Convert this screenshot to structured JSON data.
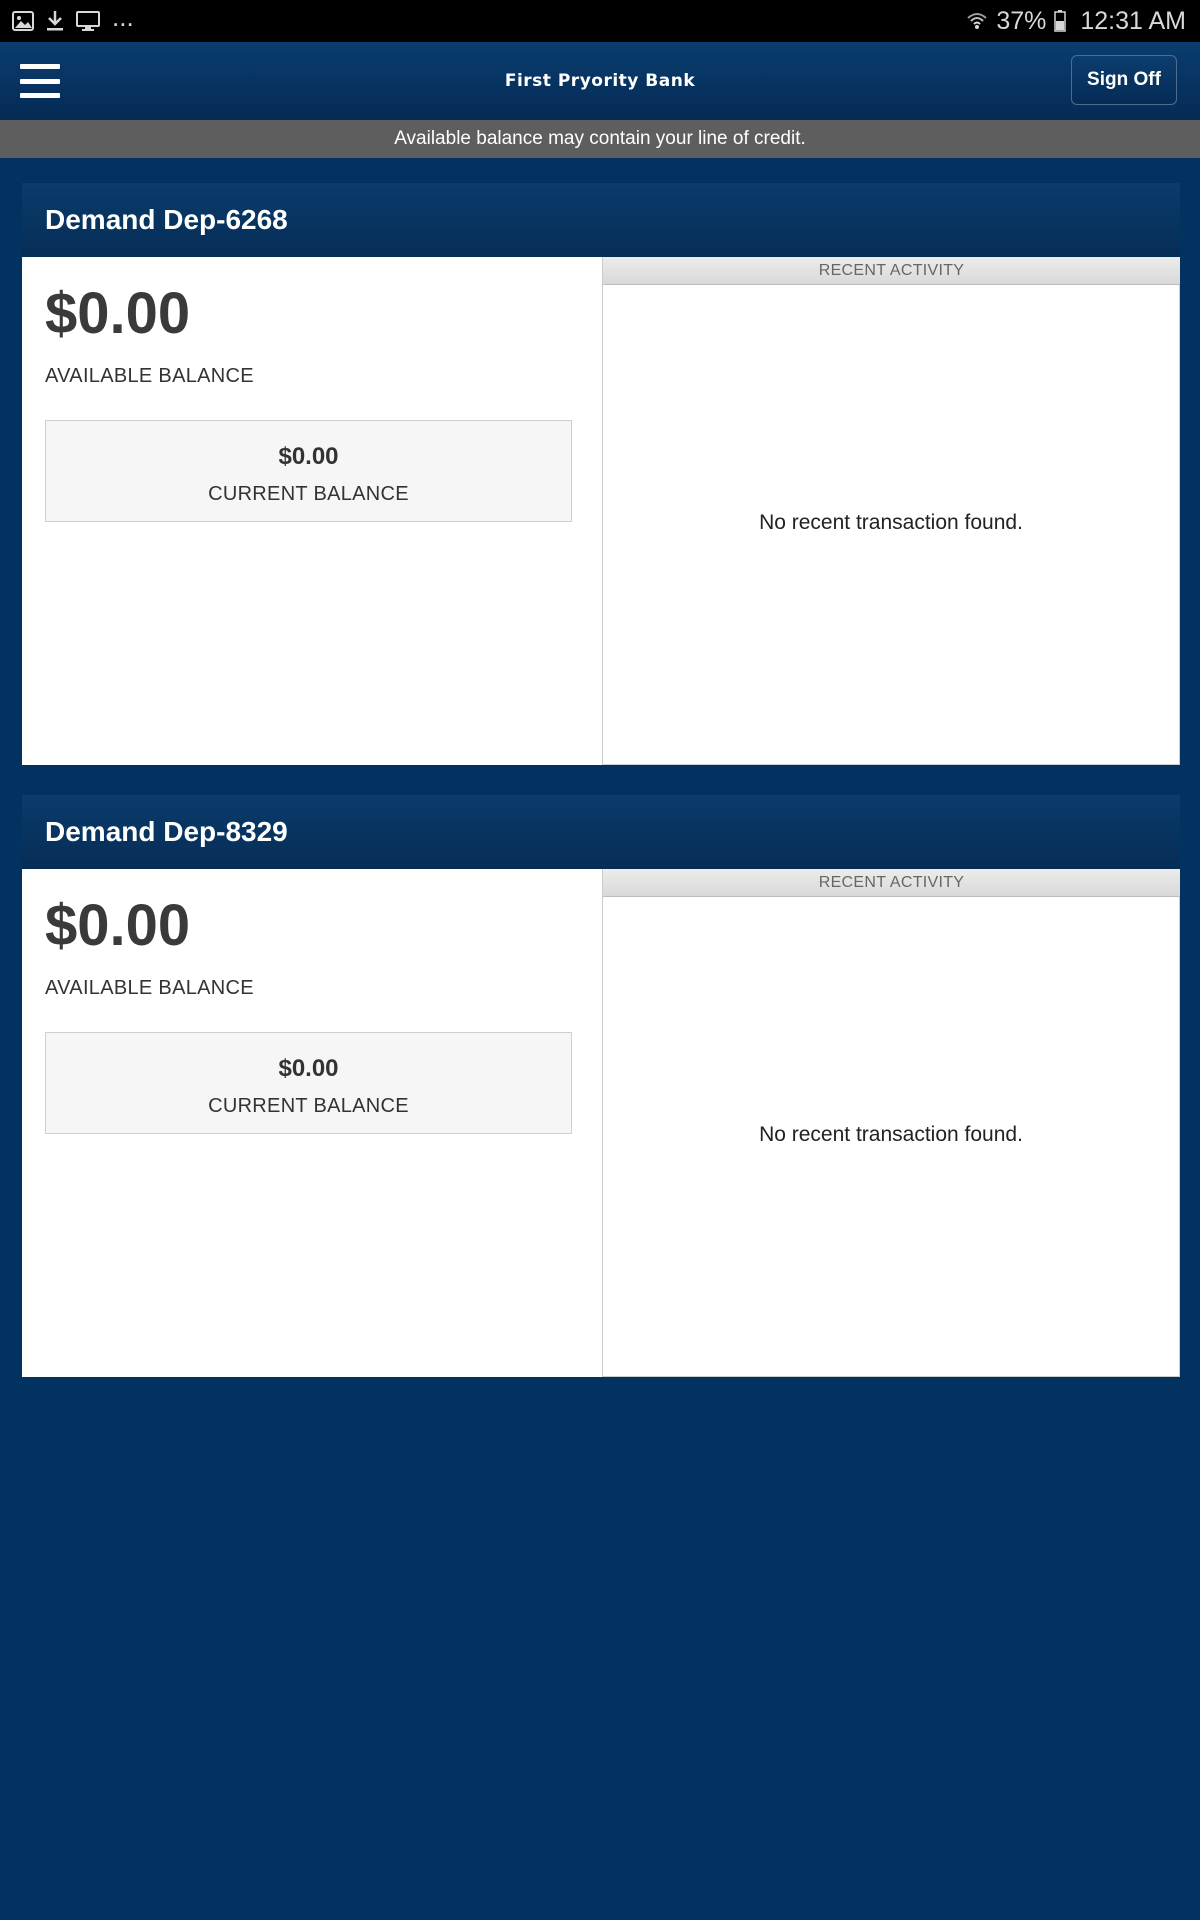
{
  "status_bar": {
    "left_icons": [
      "image-icon",
      "download-icon",
      "monitor-icon"
    ],
    "more": "...",
    "battery_percent": "37%",
    "time": "12:31 AM"
  },
  "header": {
    "title": "First Pryority Bank",
    "sign_off_label": "Sign Off"
  },
  "notice": "Available balance may contain your line of credit.",
  "accounts": [
    {
      "name": "Demand Dep-6268",
      "available_amount": "$0.00",
      "available_label": "AVAILABLE BALANCE",
      "current_amount": "$0.00",
      "current_label": "CURRENT BALANCE",
      "activity_title": "RECENT ACTIVITY",
      "activity_empty": "No recent transaction found."
    },
    {
      "name": "Demand Dep-8329",
      "available_amount": "$0.00",
      "available_label": "AVAILABLE BALANCE",
      "current_amount": "$0.00",
      "current_label": "CURRENT BALANCE",
      "activity_title": "RECENT ACTIVITY",
      "activity_empty": "No recent transaction found."
    }
  ],
  "colors": {
    "page_background": "#02325f",
    "header_background": "#052b55",
    "notice_background": "#5e5e5e"
  }
}
